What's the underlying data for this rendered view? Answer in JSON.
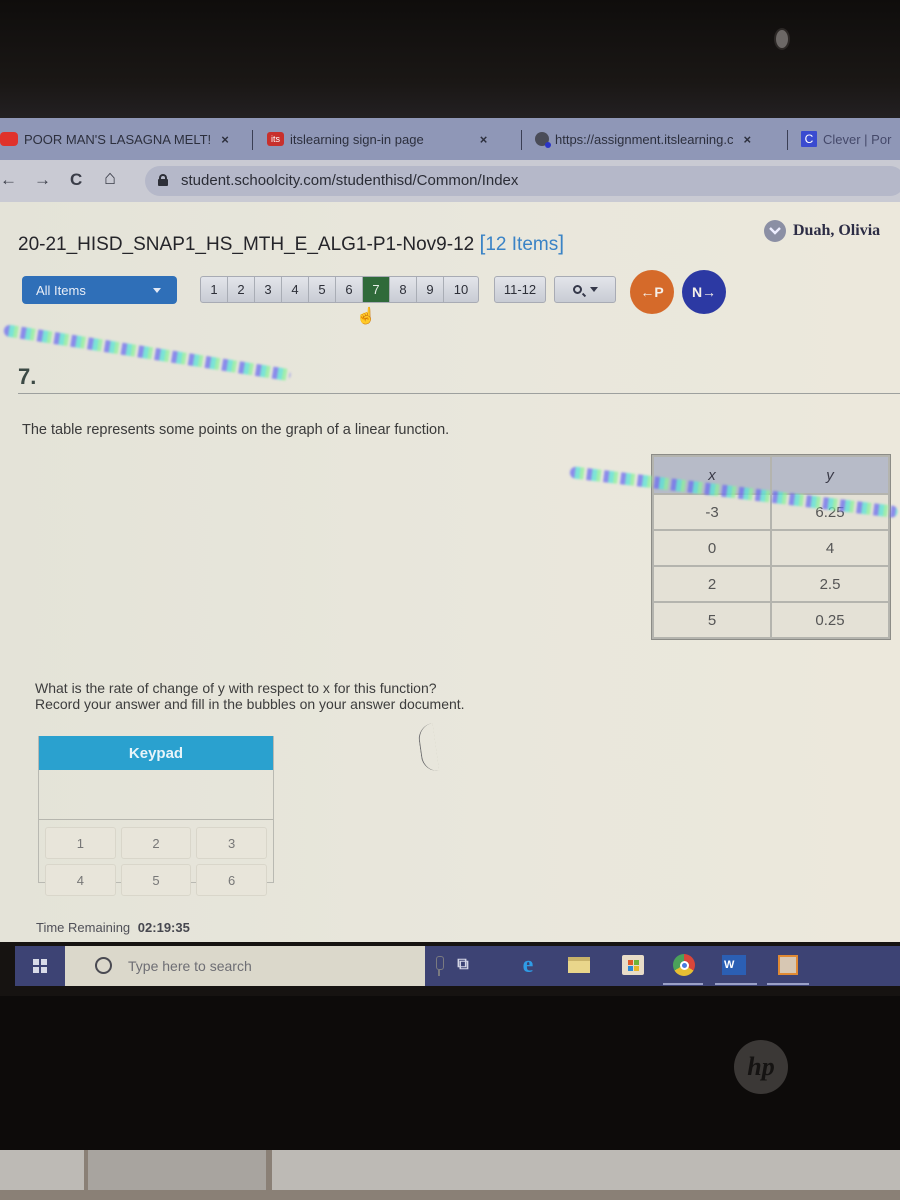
{
  "browser": {
    "tabs": [
      {
        "label": "POOR MAN'S LASAGNA MELT!",
        "favicon": "youtube-icon",
        "favicon_color": "#e0322b"
      },
      {
        "label": "itslearning sign-in page",
        "favicon": "its",
        "favicon_color": "#c8302c"
      },
      {
        "label": "https://assignment.itslearning.c",
        "favicon": "globe-icon"
      },
      {
        "label": "Clever | Por",
        "favicon": "C",
        "favicon_color": "#3a4bd0"
      }
    ],
    "close_glyph": "×",
    "nav": {
      "back": "←",
      "forward": "→",
      "reload": "C",
      "home": "⌂"
    },
    "url": "student.schoolcity.com/studenthisd/Common/Index"
  },
  "header": {
    "test_title": "20-21_HISD_SNAP1_HS_MTH_E_ALG1-P1-Nov9-12 ",
    "items_open": "[",
    "items_count": "12 Items",
    "items_close": "]",
    "user_name": "Duah, Olivia"
  },
  "nav": {
    "filter_label": "All Items",
    "pages": [
      "1",
      "2",
      "3",
      "4",
      "5",
      "6",
      "7",
      "8",
      "9",
      "10"
    ],
    "active_page": "7",
    "page_group": "11-12",
    "prev_label": "←P",
    "next_label": "N→",
    "accent_active": "#2f6a3a"
  },
  "question": {
    "number": "7.",
    "prompt": "The table represents some points on the graph of a linear function.",
    "table": {
      "headers": [
        "x",
        "y"
      ],
      "rows": [
        [
          "-3",
          "6.25"
        ],
        [
          "0",
          "4"
        ],
        [
          "2",
          "2.5"
        ],
        [
          "5",
          "0.25"
        ]
      ]
    },
    "ask_line1": "What is the rate of change of y with respect to x for this function?",
    "ask_line2": "Record your answer and fill in the bubbles on your answer document."
  },
  "keypad": {
    "title": "Keypad",
    "keys": [
      "1",
      "2",
      "3",
      "4",
      "5",
      "6"
    ]
  },
  "timer": {
    "label": "Time Remaining",
    "value": "02:19:35"
  },
  "taskbar": {
    "search_placeholder": "Type here to search",
    "apps": [
      "task-view",
      "edge",
      "file-explorer",
      "store",
      "chrome",
      "word",
      "media-player"
    ]
  },
  "device": {
    "brand": "hp"
  }
}
